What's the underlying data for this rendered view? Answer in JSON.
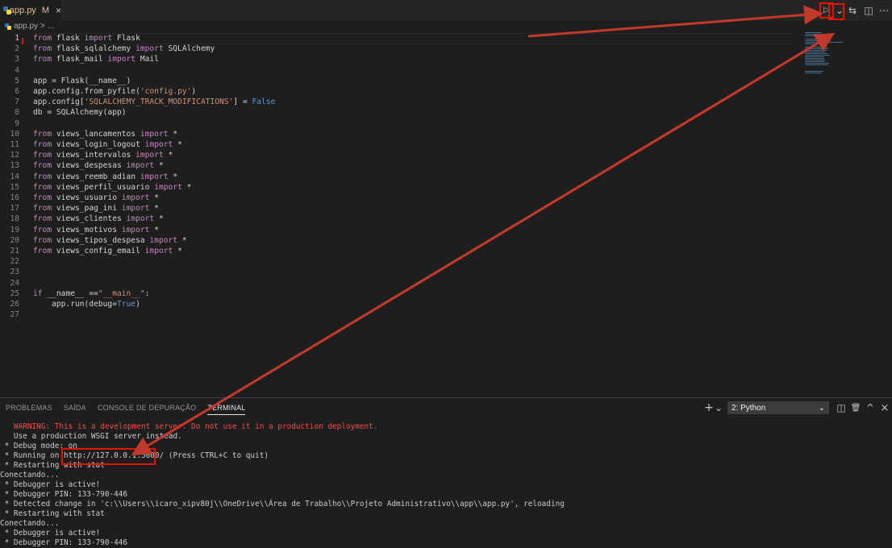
{
  "tab": {
    "filename": "app.py",
    "status": "M",
    "close": "×"
  },
  "actions": {
    "run_icon": "▷",
    "dropdown_icon": "⌄",
    "diff_icon": "⇆",
    "split_icon": "◫",
    "more_icon": "⋯"
  },
  "breadcrumb": {
    "file": "app.py",
    "sep": ">",
    "rest": "..."
  },
  "code_lines": [
    {
      "n": "1",
      "tokens": [
        [
          "kw2",
          "from"
        ],
        [
          "plain",
          " flask "
        ],
        [
          "kw2",
          "import"
        ],
        [
          "plain",
          " Flask"
        ]
      ]
    },
    {
      "n": "2",
      "tokens": [
        [
          "kw2",
          "from"
        ],
        [
          "plain",
          " flask_sqlalchemy "
        ],
        [
          "kw2",
          "import"
        ],
        [
          "plain",
          " SQLAlchemy"
        ]
      ]
    },
    {
      "n": "3",
      "tokens": [
        [
          "kw2",
          "from"
        ],
        [
          "plain",
          " flask_mail "
        ],
        [
          "kw2",
          "import"
        ],
        [
          "plain",
          " Mail"
        ]
      ]
    },
    {
      "n": "4",
      "tokens": []
    },
    {
      "n": "5",
      "tokens": [
        [
          "plain",
          "app = Flask(__name__)"
        ]
      ]
    },
    {
      "n": "6",
      "tokens": [
        [
          "plain",
          "app.config.from_pyfile("
        ],
        [
          "str",
          "'config.py'"
        ],
        [
          "plain",
          ")"
        ]
      ]
    },
    {
      "n": "7",
      "tokens": [
        [
          "plain",
          "app.config["
        ],
        [
          "str",
          "'SQLALCHEMY_TRACK_MODIFICATIONS'"
        ],
        [
          "plain",
          "] = "
        ],
        [
          "kw",
          "False"
        ]
      ]
    },
    {
      "n": "8",
      "tokens": [
        [
          "plain",
          "db = SQLAlchemy(app)"
        ]
      ]
    },
    {
      "n": "9",
      "tokens": []
    },
    {
      "n": "10",
      "tokens": [
        [
          "kw2",
          "from"
        ],
        [
          "plain",
          " views_lancamentos "
        ],
        [
          "kw2",
          "import"
        ],
        [
          "plain",
          " *"
        ]
      ]
    },
    {
      "n": "11",
      "tokens": [
        [
          "kw2",
          "from"
        ],
        [
          "plain",
          " views_login_logout "
        ],
        [
          "kw2",
          "import"
        ],
        [
          "plain",
          " *"
        ]
      ]
    },
    {
      "n": "12",
      "tokens": [
        [
          "kw2",
          "from"
        ],
        [
          "plain",
          " views_intervalos "
        ],
        [
          "kw2",
          "import"
        ],
        [
          "plain",
          " *"
        ]
      ]
    },
    {
      "n": "13",
      "tokens": [
        [
          "kw2",
          "from"
        ],
        [
          "plain",
          " views_despesas "
        ],
        [
          "kw2",
          "import"
        ],
        [
          "plain",
          " *"
        ]
      ]
    },
    {
      "n": "14",
      "tokens": [
        [
          "kw2",
          "from"
        ],
        [
          "plain",
          " views_reemb_adian "
        ],
        [
          "kw2",
          "import"
        ],
        [
          "plain",
          " *"
        ]
      ]
    },
    {
      "n": "15",
      "tokens": [
        [
          "kw2",
          "from"
        ],
        [
          "plain",
          " views_perfil_usuario "
        ],
        [
          "kw2",
          "import"
        ],
        [
          "plain",
          " *"
        ]
      ]
    },
    {
      "n": "16",
      "tokens": [
        [
          "kw2",
          "from"
        ],
        [
          "plain",
          " views_usuario "
        ],
        [
          "kw2",
          "import"
        ],
        [
          "plain",
          " *"
        ]
      ]
    },
    {
      "n": "17",
      "tokens": [
        [
          "kw2",
          "from"
        ],
        [
          "plain",
          " views_pag_ini "
        ],
        [
          "kw2",
          "import"
        ],
        [
          "plain",
          " *"
        ]
      ]
    },
    {
      "n": "18",
      "tokens": [
        [
          "kw2",
          "from"
        ],
        [
          "plain",
          " views_clientes "
        ],
        [
          "kw2",
          "import"
        ],
        [
          "plain",
          " *"
        ]
      ]
    },
    {
      "n": "19",
      "tokens": [
        [
          "kw2",
          "from"
        ],
        [
          "plain",
          " views_motivos "
        ],
        [
          "kw2",
          "import"
        ],
        [
          "plain",
          " *"
        ]
      ]
    },
    {
      "n": "20",
      "tokens": [
        [
          "kw2",
          "from"
        ],
        [
          "plain",
          " views_tipos_despesa "
        ],
        [
          "kw2",
          "import"
        ],
        [
          "plain",
          " *"
        ]
      ]
    },
    {
      "n": "21",
      "tokens": [
        [
          "kw2",
          "from"
        ],
        [
          "plain",
          " views_config_email "
        ],
        [
          "kw2",
          "import"
        ],
        [
          "plain",
          " *"
        ]
      ]
    },
    {
      "n": "22",
      "tokens": []
    },
    {
      "n": "23",
      "tokens": []
    },
    {
      "n": "24",
      "tokens": []
    },
    {
      "n": "25",
      "tokens": [
        [
          "kw2",
          "if"
        ],
        [
          "plain",
          " __name__ =="
        ],
        [
          "str",
          "\"__main__\""
        ],
        [
          "plain",
          ":"
        ]
      ]
    },
    {
      "n": "26",
      "tokens": [
        [
          "plain",
          "    app.run(debug="
        ],
        [
          "kw",
          "True"
        ],
        [
          "plain",
          ")"
        ]
      ]
    },
    {
      "n": "27",
      "tokens": []
    }
  ],
  "panel": {
    "tabs": [
      "PROBLEMAS",
      "SAÍDA",
      "CONSOLE DE DEPURAÇÃO",
      "TERMINAL"
    ],
    "active_tab": "TERMINAL",
    "terminal_select": "2: Python",
    "add_icon": "+",
    "chevron_icon": "⌄",
    "split_icon": "◫",
    "trash_icon": "🗑",
    "maximize_icon": "^",
    "close_icon": "×"
  },
  "terminal_lines": [
    {
      "cls": "warn",
      "text": "   WARNING: This is a development server. Do not use it in a production deployment."
    },
    {
      "cls": "",
      "text": "   Use a production WSGI server instead."
    },
    {
      "cls": "",
      "text": " * Debug mode: on"
    },
    {
      "cls": "",
      "text": " * Running on http://127.0.0.1:5000/ (Press CTRL+C to quit)"
    },
    {
      "cls": "",
      "text": " * Restarting with stat"
    },
    {
      "cls": "",
      "text": "Conectando..."
    },
    {
      "cls": "",
      "text": " * Debugger is active!"
    },
    {
      "cls": "",
      "text": " * Debugger PIN: 133-790-446"
    },
    {
      "cls": "",
      "text": " * Detected change in 'c:\\\\Users\\\\icaro_xipv80j\\\\OneDrive\\\\Área de Trabalho\\\\Projeto Administrativo\\\\app\\\\app.py', reloading"
    },
    {
      "cls": "",
      "text": " * Restarting with stat"
    },
    {
      "cls": "",
      "text": "Conectando..."
    },
    {
      "cls": "",
      "text": " * Debugger is active!"
    },
    {
      "cls": "",
      "text": " * Debugger PIN: 133-790-446"
    }
  ],
  "colors": {
    "annotation": "#c0392b",
    "highlight_box": "#e51400"
  }
}
